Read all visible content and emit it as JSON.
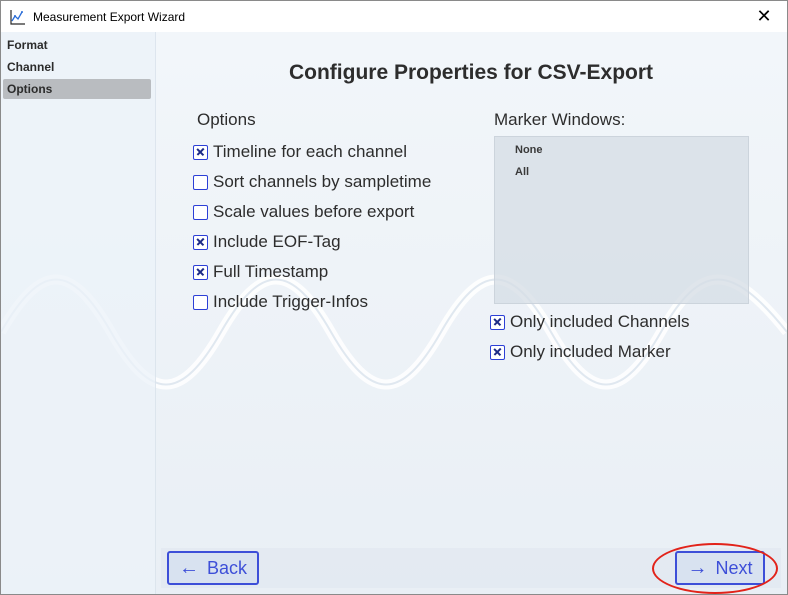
{
  "window": {
    "title": "Measurement Export Wizard",
    "close_glyph": "✕"
  },
  "nav": {
    "items": [
      {
        "label": "Format",
        "active": false
      },
      {
        "label": "Channel",
        "active": false
      },
      {
        "label": "Options",
        "active": true
      }
    ]
  },
  "main": {
    "title": "Configure Properties for CSV-Export",
    "options_label": "Options",
    "options": [
      {
        "label": "Timeline for each channel",
        "checked": true
      },
      {
        "label": "Sort channels by sampletime",
        "checked": false
      },
      {
        "label": "Scale values before export",
        "checked": false
      },
      {
        "label": "Include EOF-Tag",
        "checked": true
      },
      {
        "label": "Full Timestamp",
        "checked": true
      },
      {
        "label": "Include Trigger-Infos",
        "checked": false
      }
    ],
    "marker_windows_label": "Marker Windows:",
    "marker_windows": [
      "None",
      "All"
    ],
    "filters": [
      {
        "label": "Only included Channels",
        "checked": true
      },
      {
        "label": "Only included Marker",
        "checked": true
      }
    ]
  },
  "footer": {
    "back_label": "Back",
    "next_label": "Next",
    "back_arrow": "←",
    "next_arrow": "→"
  },
  "colors": {
    "accent": "#3d4fd8",
    "checkbox_border": "#2c3fd6",
    "highlight_ring": "#e2231a",
    "nav_active": "#b9bcc0"
  },
  "icons": {
    "title": "chart-line-icon",
    "close": "close-icon"
  }
}
